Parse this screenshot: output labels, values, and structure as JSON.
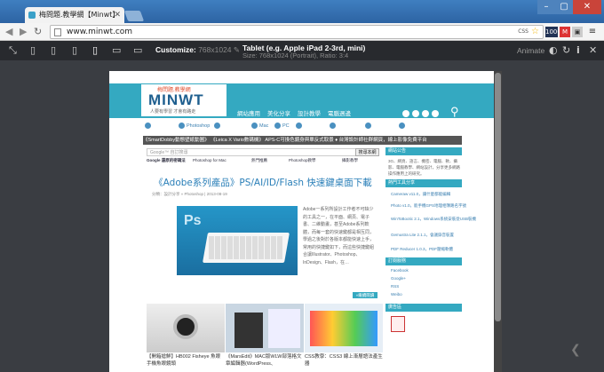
{
  "browser": {
    "tab_title": "梅問題.教學網【Minwt】",
    "url": "www.minwt.com",
    "css_label": "CSS",
    "badge": "1000",
    "window_buttons": {
      "minimize": "–",
      "maximize": "▢",
      "close": "✕"
    }
  },
  "devicebar": {
    "customize_label": "Customize:",
    "customize_value": "768x1024",
    "device_name": "Tablet (e.g. Apple iPad 2-3rd, mini)",
    "device_size": "Size: 768x1024 (Portrait), Ratio: 3:4",
    "animate_label": "Animate",
    "icons": [
      "fullscreen-icon",
      "phone-small-icon",
      "phone-icon",
      "phone-large-icon",
      "tablet-icon",
      "laptop-icon",
      "desktop-icon",
      "pencil-icon",
      "half-circle-icon",
      "rotate-icon",
      "info-icon",
      "close-icon"
    ]
  },
  "site": {
    "logo_top": "梅問題.教學網",
    "logo_main": "MINWT",
    "logo_sub": "人要有學習 才會有路走",
    "nav": [
      "網站應用",
      "美化分享",
      "設計教學",
      "電腦週邊"
    ],
    "categories": [
      "Photoshop",
      "AI",
      "圖片處理",
      "Mac",
      "PC",
      "拍攝",
      "Web",
      "網站",
      "電子商務",
      "Android",
      "開發工具"
    ],
    "ticker": "《SmartDobby動態壁紙動圖》  《Leica X Vario數碼機》 APS-C可換色鏡身與單反式取景    ♦ 台灣設計師社群網頁，線上影像免費平台",
    "search_placeholder": "Google™ 自訂搜尋",
    "search_button": "搜尋本網",
    "tags": [
      "Google 還原的密碼法",
      "Photoshop for Mac",
      "熱門推薦",
      "Photoshop教學",
      "攝影教學"
    ],
    "post_title": "《Adobe系列產品》PS/AI/ID/Flash 快速鍵桌面下載",
    "post_meta": "分類：設計分享 » Photoshop | 2013-08-19",
    "post_text": "Adobe一系列所設計工作者不可缺少的工具之一，在平面、網頁、電子書、二維動畫，甚至Adobe系列軟體，而每一套的快速鍵都是相互同，學過之後對於各版本都能快速上手，常用的快捷鍵如下，而這些快捷鍵組合讓Illustrator、Photoshop、InDesign、Flash，在…",
    "read_more": "»繼續閱讀",
    "thumb_captions": [
      "【開箱搶鮮】HB002 Fisheye 魚眼手機魚眼鏡頭",
      "《MarsEdit》MAC版WLW部落格文章編輯器(WordPress、",
      "CSS教學：CSS3 線上漸層語法產生器"
    ],
    "sidebar": {
      "h1": "網站公告",
      "t1": "3G、網頁、語言、機密、電腦、軟、攝影、電腦教學、網站設計，分享更多網路操作應用上的研究。",
      "h2": "熱門工具分享",
      "links": [
        "Cameraw v11.0，讓什麼都能編輯",
        "Photo v1.0，能手機GPS地理相簿路名字號",
        "WinToBootic 2.1，Windows系統安裝從USB裝機",
        "Gemustra Lite 2.1.1，會議錄音裝置",
        "PDF Reducer 1.0.3，PDF壓縮軟體"
      ],
      "h3": "訂閱服務",
      "subs": [
        "Facebook",
        "Google+",
        "RSS",
        "Weibo"
      ],
      "h4": "廣告區"
    }
  }
}
